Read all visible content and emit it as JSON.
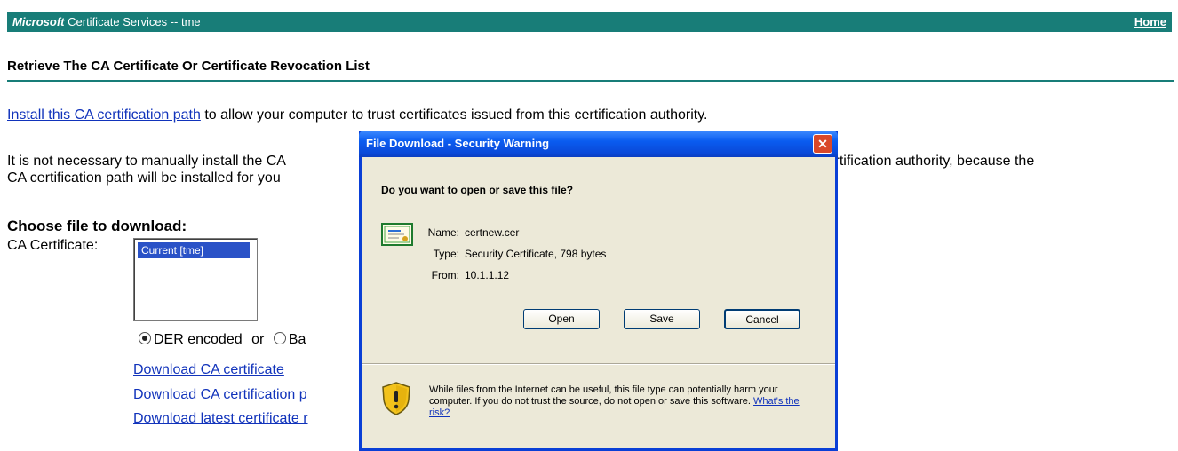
{
  "banner": {
    "brand": "Microsoft",
    "title": "Certificate Services  --  tme",
    "home_link": "Home"
  },
  "page": {
    "title": "Retrieve The CA Certificate Or Certificate Revocation List",
    "install_link": "Install this CA certification path",
    "install_text": " to allow your computer to trust certificates issued from this certification authority.",
    "para2_line1_left": "It is not necessary to manually install the CA",
    "para2_line1_right": "n this certification authority, because the",
    "para2_line2": "CA certification path will be installed for you",
    "choose_heading": "Choose file to download:",
    "ca_label": "CA Certificate:",
    "list_selected": "Current [tme]",
    "radio_der": "DER encoded",
    "radio_or": "or",
    "radio_base": "Ba",
    "download_links": [
      "Download CA certificate",
      "Download CA certification p",
      "Download latest certificate r"
    ]
  },
  "dialog": {
    "title": "File Download - Security Warning",
    "question": "Do you want to open or save this file?",
    "name_label": "Name:",
    "name_value": "certnew.cer",
    "type_label": "Type:",
    "type_value": "Security Certificate, 798 bytes",
    "from_label": "From:",
    "from_value": "10.1.1.12",
    "open_btn": "Open",
    "save_btn": "Save",
    "cancel_btn": "Cancel",
    "warning_text": "While files from the Internet can be useful, this file type can potentially harm your computer. If you do not trust the source, do not open or save this software. ",
    "risk_link": "What's the risk?"
  },
  "colors": {
    "banner": "#187d78",
    "titlebar": "#0a5cf0",
    "dialog_bg": "#ece9d8",
    "link": "#1133bb"
  }
}
